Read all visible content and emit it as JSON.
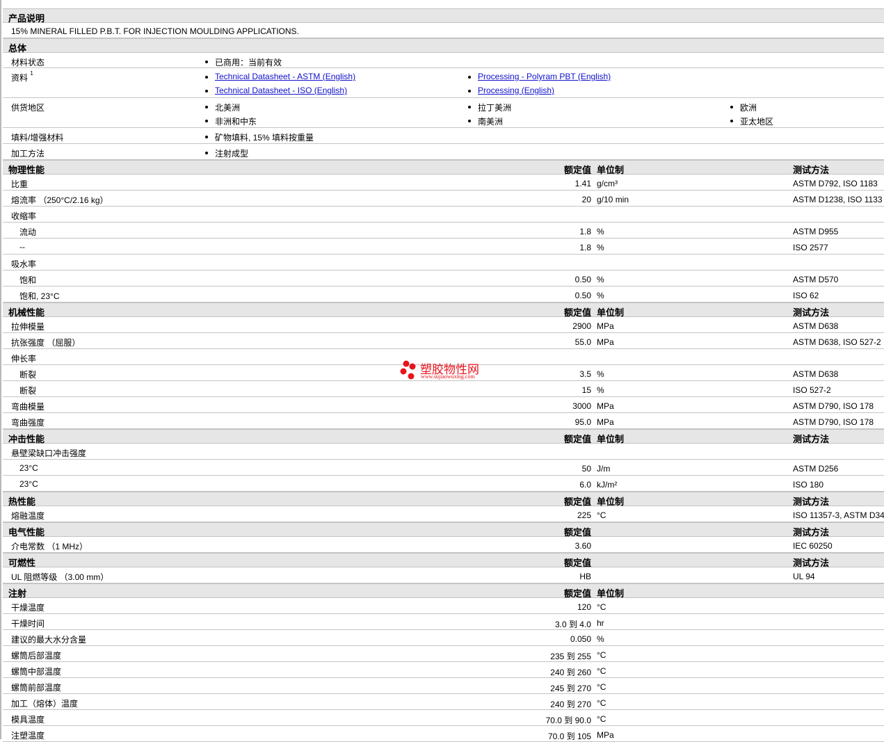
{
  "desc_header": "产品说明",
  "desc": "15% MINERAL FILLED P.B.T. FOR INJECTION MOULDING APPLICATIONS.",
  "general": {
    "title": "总体",
    "status_label": "材料状态",
    "status": "已商用：当前有效",
    "docs_label": "资料",
    "docs_sup": "1",
    "docs": [
      "Technical Datasheet - ASTM (English)",
      "Technical Datasheet - ISO (English)",
      "Processing - Polyram PBT (English)",
      "Processing (English)"
    ],
    "regions_label": "供货地区",
    "regions": [
      "北美洲",
      "非洲和中东",
      "拉丁美洲",
      "南美洲",
      "欧洲",
      "亚太地区"
    ],
    "filler_label": "填料/增强材料",
    "filler": "矿物填料, 15% 填料按重量",
    "process_label": "加工方法",
    "process": "注射成型"
  },
  "watermark": {
    "name": "塑胶物性网",
    "url": "www.sujiaowuxing.com",
    "color": "#e8141c"
  },
  "sections": [
    {
      "title": "物理性能",
      "h_val": "额定值",
      "h_unit": "单位制",
      "h_tm": "测试方法",
      "rows": [
        {
          "l": "比重",
          "v": "1.41",
          "u": "g/cm³",
          "t": "ASTM D792, ISO 1183"
        },
        {
          "l": "熔流率 （250°C/2.16 kg）",
          "v": "20",
          "u": "g/10 min",
          "t": "ASTM D1238, ISO 1133"
        },
        {
          "l": "收缩率"
        },
        {
          "l": "流动",
          "sub": true,
          "v": "1.8",
          "u": "%",
          "t": "ASTM D955"
        },
        {
          "l": "--",
          "sub": true,
          "v": "1.8",
          "u": "%",
          "t": "ISO 2577"
        },
        {
          "l": "吸水率"
        },
        {
          "l": "饱和",
          "sub": true,
          "v": "0.50",
          "u": "%",
          "t": "ASTM D570"
        },
        {
          "l": "饱和, 23°C",
          "sub": true,
          "v": "0.50",
          "u": "%",
          "t": "ISO 62"
        }
      ]
    },
    {
      "title": "机械性能",
      "h_val": "额定值",
      "h_unit": "单位制",
      "h_tm": "测试方法",
      "rows": [
        {
          "l": "拉伸模量",
          "v": "2900",
          "u": "MPa",
          "t": "ASTM D638"
        },
        {
          "l": "抗张强度 （屈服）",
          "v": "55.0",
          "u": "MPa",
          "t": "ASTM D638, ISO 527-2"
        },
        {
          "l": "伸长率"
        },
        {
          "l": "断裂",
          "sub": true,
          "v": "3.5",
          "u": "%",
          "t": "ASTM D638"
        },
        {
          "l": "断裂",
          "sub": true,
          "v": "15",
          "u": "%",
          "t": "ISO 527-2"
        },
        {
          "l": "弯曲模量",
          "v": "3000",
          "u": "MPa",
          "t": "ASTM D790, ISO 178"
        },
        {
          "l": "弯曲强度",
          "v": "95.0",
          "u": "MPa",
          "t": "ASTM D790, ISO 178"
        }
      ]
    },
    {
      "title": "冲击性能",
      "h_val": "额定值",
      "h_unit": "单位制",
      "h_tm": "测试方法",
      "rows": [
        {
          "l": "悬壁梁缺口冲击强度"
        },
        {
          "l": "23°C",
          "sub": true,
          "v": "50",
          "u": "J/m",
          "t": "ASTM D256"
        },
        {
          "l": "23°C",
          "sub": true,
          "v": "6.0",
          "u": "kJ/m²",
          "t": "ISO 180"
        }
      ]
    },
    {
      "title": "热性能",
      "h_val": "额定值",
      "h_unit": "单位制",
      "h_tm": "测试方法",
      "rows": [
        {
          "l": "熔融温度",
          "v": "225",
          "u": "°C",
          "t": "ISO 11357-3, ASTM D34"
        }
      ]
    },
    {
      "title": "电气性能",
      "h_val": "额定值",
      "h_tm": "测试方法",
      "rows": [
        {
          "l": "介电常数 （1 MHz）",
          "v": "3.60",
          "t": "IEC 60250"
        }
      ]
    },
    {
      "title": "可燃性",
      "h_val": "额定值",
      "h_tm": "测试方法",
      "rows": [
        {
          "l": "UL 阻燃等级 （3.00 mm）",
          "v": "HB",
          "t": "UL 94"
        }
      ]
    },
    {
      "title": "注射",
      "h_val": "额定值",
      "h_unit": "单位制",
      "rows": [
        {
          "l": "干燥温度",
          "v": "120",
          "u": "°C"
        },
        {
          "l": "干燥时间",
          "v": "3.0 到  4.0",
          "u": "hr"
        },
        {
          "l": "建议的最大水分含量",
          "v": "0.050",
          "u": "%"
        },
        {
          "l": "螺筒后部温度",
          "v": "235 到  255",
          "u": "°C"
        },
        {
          "l": "螺筒中部温度",
          "v": "240 到  260",
          "u": "°C"
        },
        {
          "l": "螺筒前部温度",
          "v": "245 到  270",
          "u": "°C"
        },
        {
          "l": "加工（熔体）温度",
          "v": "240 到  270",
          "u": "°C"
        },
        {
          "l": "模具温度",
          "v": "70.0 到  90.0",
          "u": "°C"
        },
        {
          "l": "注塑温度",
          "v": "70.0 到  105",
          "u": "MPa"
        }
      ]
    }
  ]
}
